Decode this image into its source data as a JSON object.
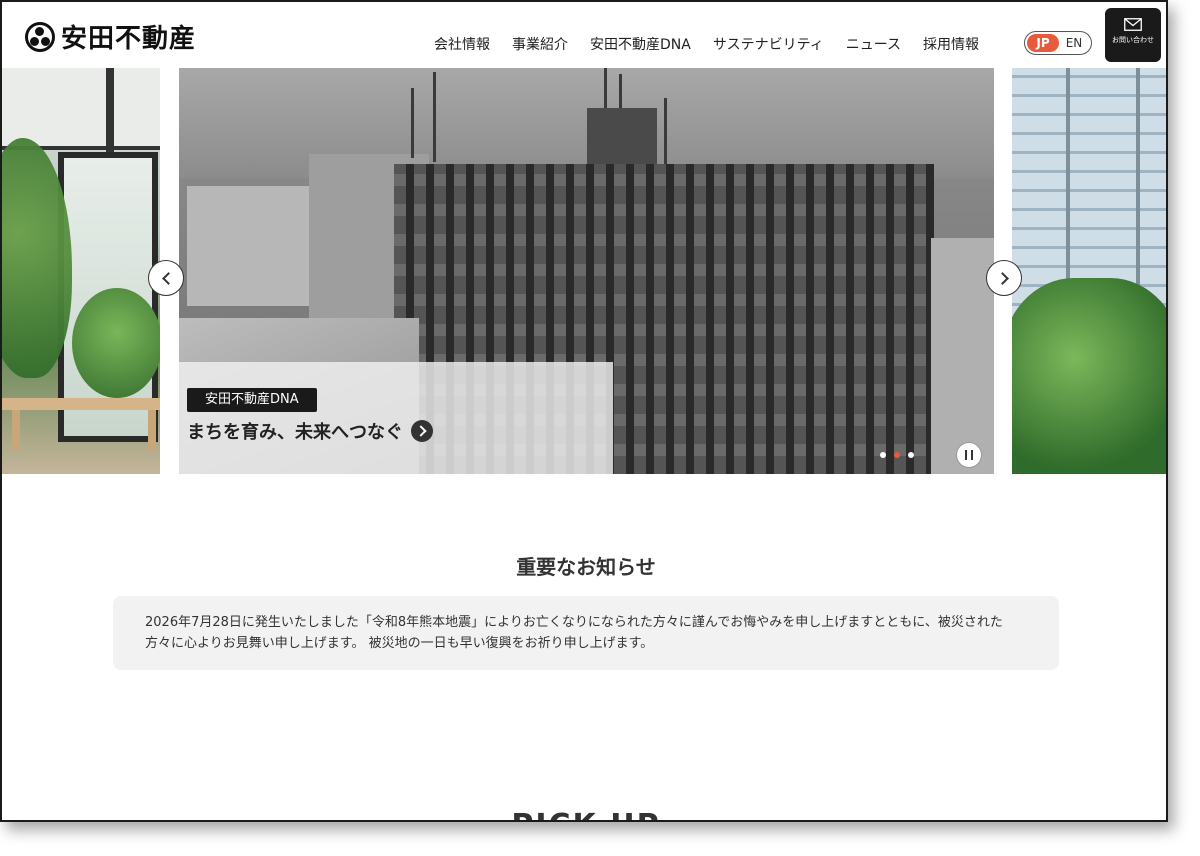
{
  "header": {
    "logo_text": "安田不動産",
    "nav": [
      "会社情報",
      "事業紹介",
      "安田不動産DNA",
      "サステナビリティ",
      "ニュース",
      "採用情報"
    ],
    "lang": {
      "jp": "JP",
      "en": "EN",
      "active": "JP"
    },
    "contact_label": "お問い合わせ"
  },
  "carousel": {
    "tag": "安田不動産DNA",
    "title": "まちを育み、未来へつなぐ",
    "slide_count": 3,
    "active_index": 1
  },
  "notice": {
    "heading": "重要なお知らせ",
    "body": "2026年7月28日に発生いたしました「令和8年熊本地震」によりお亡くなりになられた方々に謹んでお悔やみを申し上げますとともに、被災された方々に心よりお見舞い申し上げます。 被災地の一日も早い復興をお祈り申し上げます。"
  },
  "pickup": {
    "heading": "PICK UP"
  },
  "colors": {
    "accent": "#e85a3c",
    "dark": "#1a1a1a",
    "notice_bg": "#f2f2f2"
  }
}
